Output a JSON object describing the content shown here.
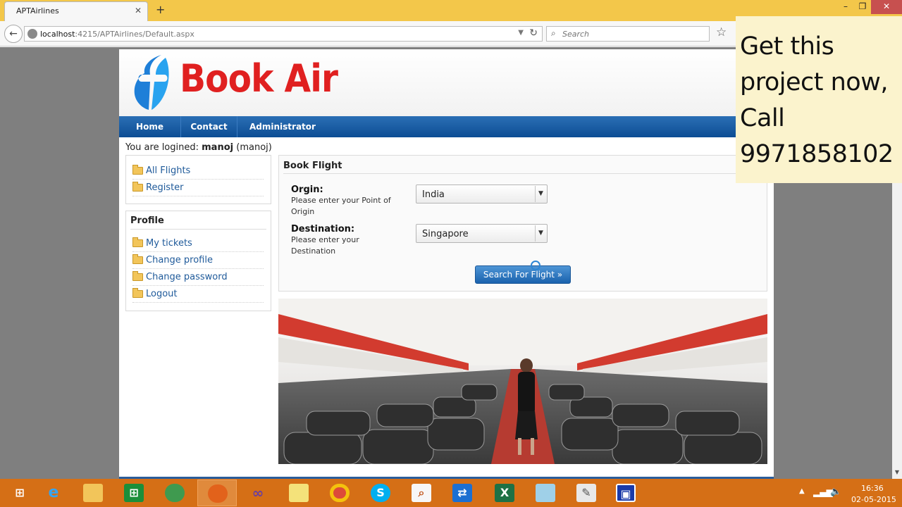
{
  "browser": {
    "tab_title": "APTAirlines",
    "tab_close": "✕",
    "new_tab": "+",
    "url_host": "localhost",
    "url_rest": ":4215/APTAirlines/Default.aspx",
    "search_placeholder": "Search"
  },
  "site": {
    "logo_text": "Book Air",
    "menu": [
      "Home",
      "Contact",
      "Administrator"
    ],
    "login": {
      "prefix": "You are logined:",
      "name": "manoj",
      "alias": "(manoj)"
    },
    "links": [
      "All Flights",
      "Register"
    ],
    "profile": {
      "heading": "Profile",
      "items": [
        "My tickets",
        "Change profile",
        "Change password",
        "Logout"
      ]
    },
    "book_flight": {
      "title": "Book Flight",
      "origin_label": "Orgin:",
      "origin_hint": "Please enter your Point of Origin",
      "origin_value": "India",
      "destination_label": "Destination:",
      "destination_hint": "Please enter your Destination",
      "destination_value": "Singapore",
      "search_button": "Search For Flight »"
    }
  },
  "promo": {
    "text": "Get this project now, Call 9971858102"
  },
  "taskbar": {
    "time": "16:36",
    "date": "02-05-2015"
  },
  "colors": {
    "titlebar": "#f3c74a",
    "menu": "#0c4d94",
    "logo_red": "#e02020",
    "logo_blue": "#1e7fd8",
    "taskbar": "#d56f16"
  }
}
